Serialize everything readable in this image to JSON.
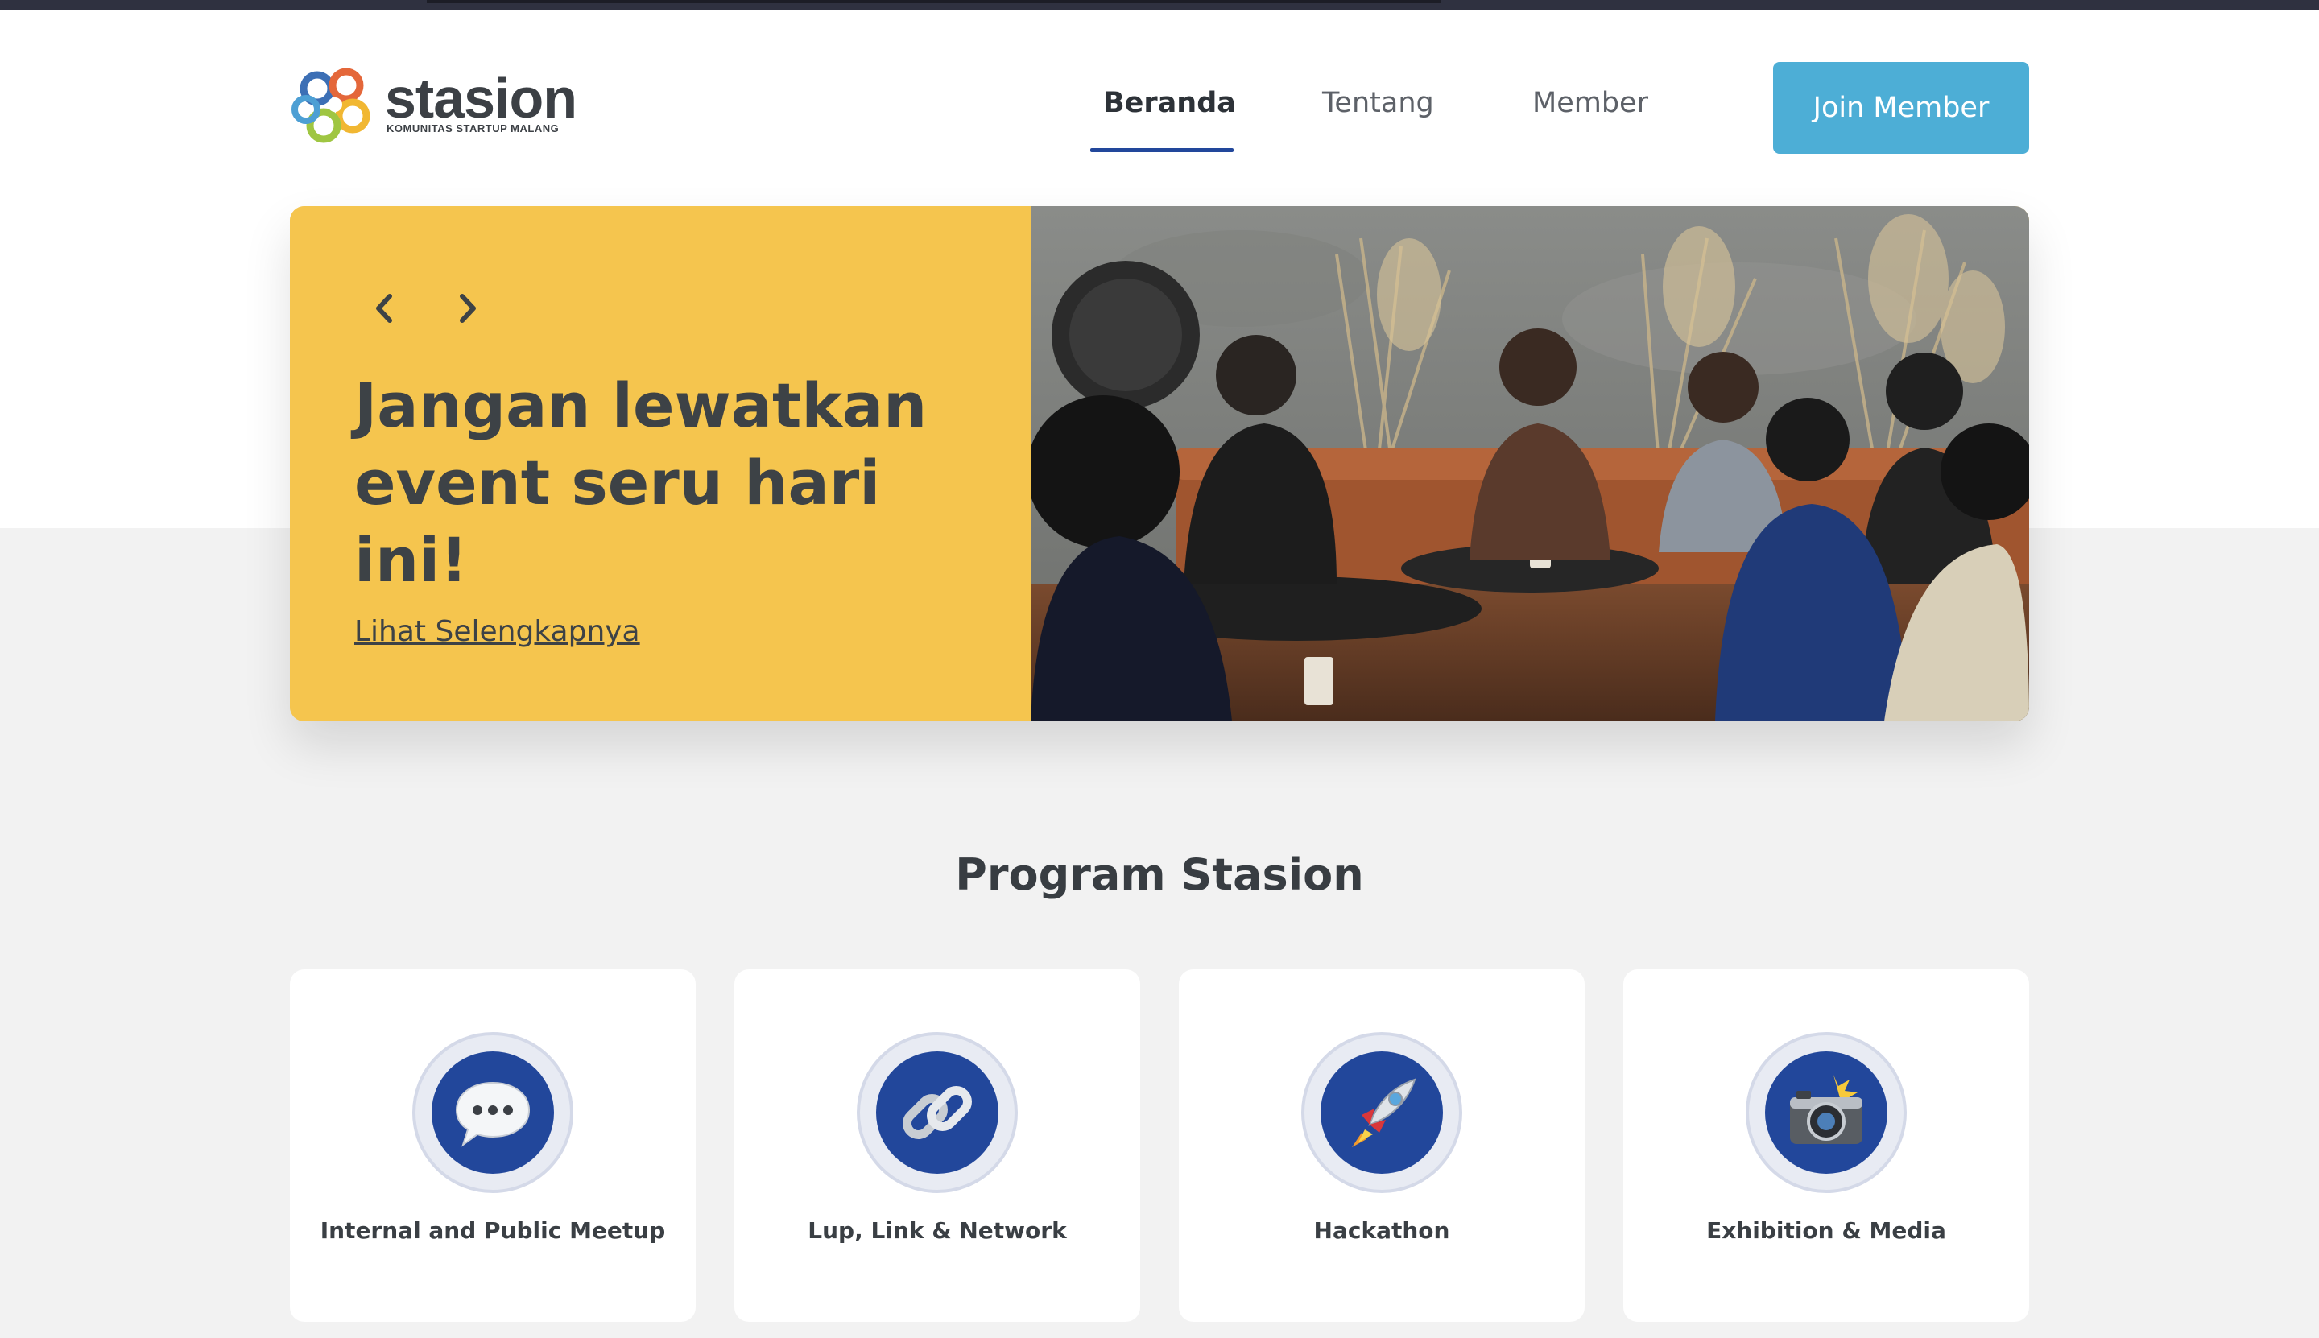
{
  "brand": {
    "name": "stasion",
    "tagline": "KOMUNITAS STARTUP MALANG"
  },
  "nav": {
    "items": [
      {
        "label": "Beranda",
        "active": true
      },
      {
        "label": "Tentang",
        "active": false
      },
      {
        "label": "Member",
        "active": false
      }
    ],
    "cta_label": "Join Member"
  },
  "hero": {
    "title": "Jangan lewatkan event seru hari ini!",
    "link_label": "Lihat Selengkapnya",
    "prev_icon": "chevron-left-icon",
    "next_icon": "chevron-right-icon"
  },
  "programs": {
    "title": "Program Stasion",
    "items": [
      {
        "label": "Internal and Public Meetup",
        "icon": "speech-bubble-icon"
      },
      {
        "label": "Lup, Link & Network",
        "icon": "chain-link-icon"
      },
      {
        "label": "Hackathon",
        "icon": "rocket-icon"
      },
      {
        "label": "Exhibition & Media",
        "icon": "camera-flash-icon"
      }
    ]
  },
  "colors": {
    "accent_yellow": "#f5c54e",
    "brand_blue": "#22479b",
    "cta_blue": "#4daed6",
    "background": "#f2f2f2"
  }
}
